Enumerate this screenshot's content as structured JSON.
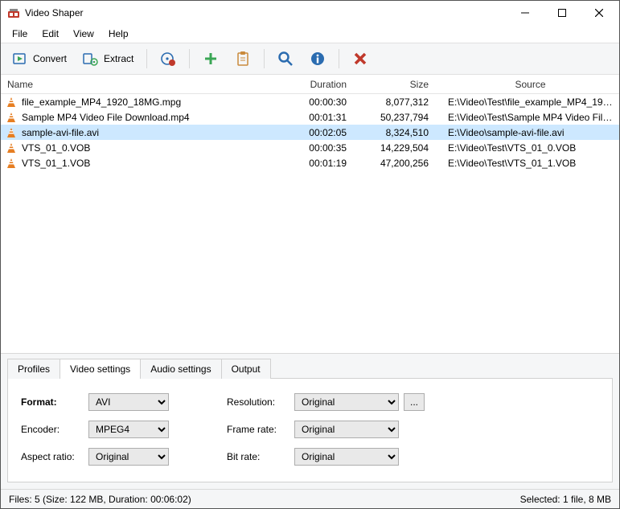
{
  "window": {
    "title": "Video Shaper"
  },
  "menu": {
    "file": "File",
    "edit": "Edit",
    "view": "View",
    "help": "Help"
  },
  "toolbar": {
    "convert": "Convert",
    "extract": "Extract"
  },
  "columns": {
    "name": "Name",
    "duration": "Duration",
    "size": "Size",
    "source": "Source"
  },
  "files": [
    {
      "name": "file_example_MP4_1920_18MG.mpg",
      "duration": "00:00:30",
      "size": "8,077,312",
      "source": "E:\\Video\\Test\\file_example_MP4_192...",
      "selected": false
    },
    {
      "name": "Sample MP4 Video File Download.mp4",
      "duration": "00:01:31",
      "size": "50,237,794",
      "source": "E:\\Video\\Test\\Sample MP4 Video File...",
      "selected": false
    },
    {
      "name": "sample-avi-file.avi",
      "duration": "00:02:05",
      "size": "8,324,510",
      "source": "E:\\Video\\sample-avi-file.avi",
      "selected": true
    },
    {
      "name": "VTS_01_0.VOB",
      "duration": "00:00:35",
      "size": "14,229,504",
      "source": "E:\\Video\\Test\\VTS_01_0.VOB",
      "selected": false
    },
    {
      "name": "VTS_01_1.VOB",
      "duration": "00:01:19",
      "size": "47,200,256",
      "source": "E:\\Video\\Test\\VTS_01_1.VOB",
      "selected": false
    }
  ],
  "tabs": {
    "profiles": "Profiles",
    "video": "Video settings",
    "audio": "Audio settings",
    "output": "Output"
  },
  "settings": {
    "format_label": "Format:",
    "format_value": "AVI",
    "encoder_label": "Encoder:",
    "encoder_value": "MPEG4",
    "aspect_label": "Aspect ratio:",
    "aspect_value": "Original",
    "resolution_label": "Resolution:",
    "resolution_value": "Original",
    "framerate_label": "Frame rate:",
    "framerate_value": "Original",
    "bitrate_label": "Bit rate:",
    "bitrate_value": "Original",
    "browse": "..."
  },
  "status": {
    "left": "Files: 5 (Size: 122 MB, Duration: 00:06:02)",
    "right": "Selected: 1 file, 8 MB"
  }
}
